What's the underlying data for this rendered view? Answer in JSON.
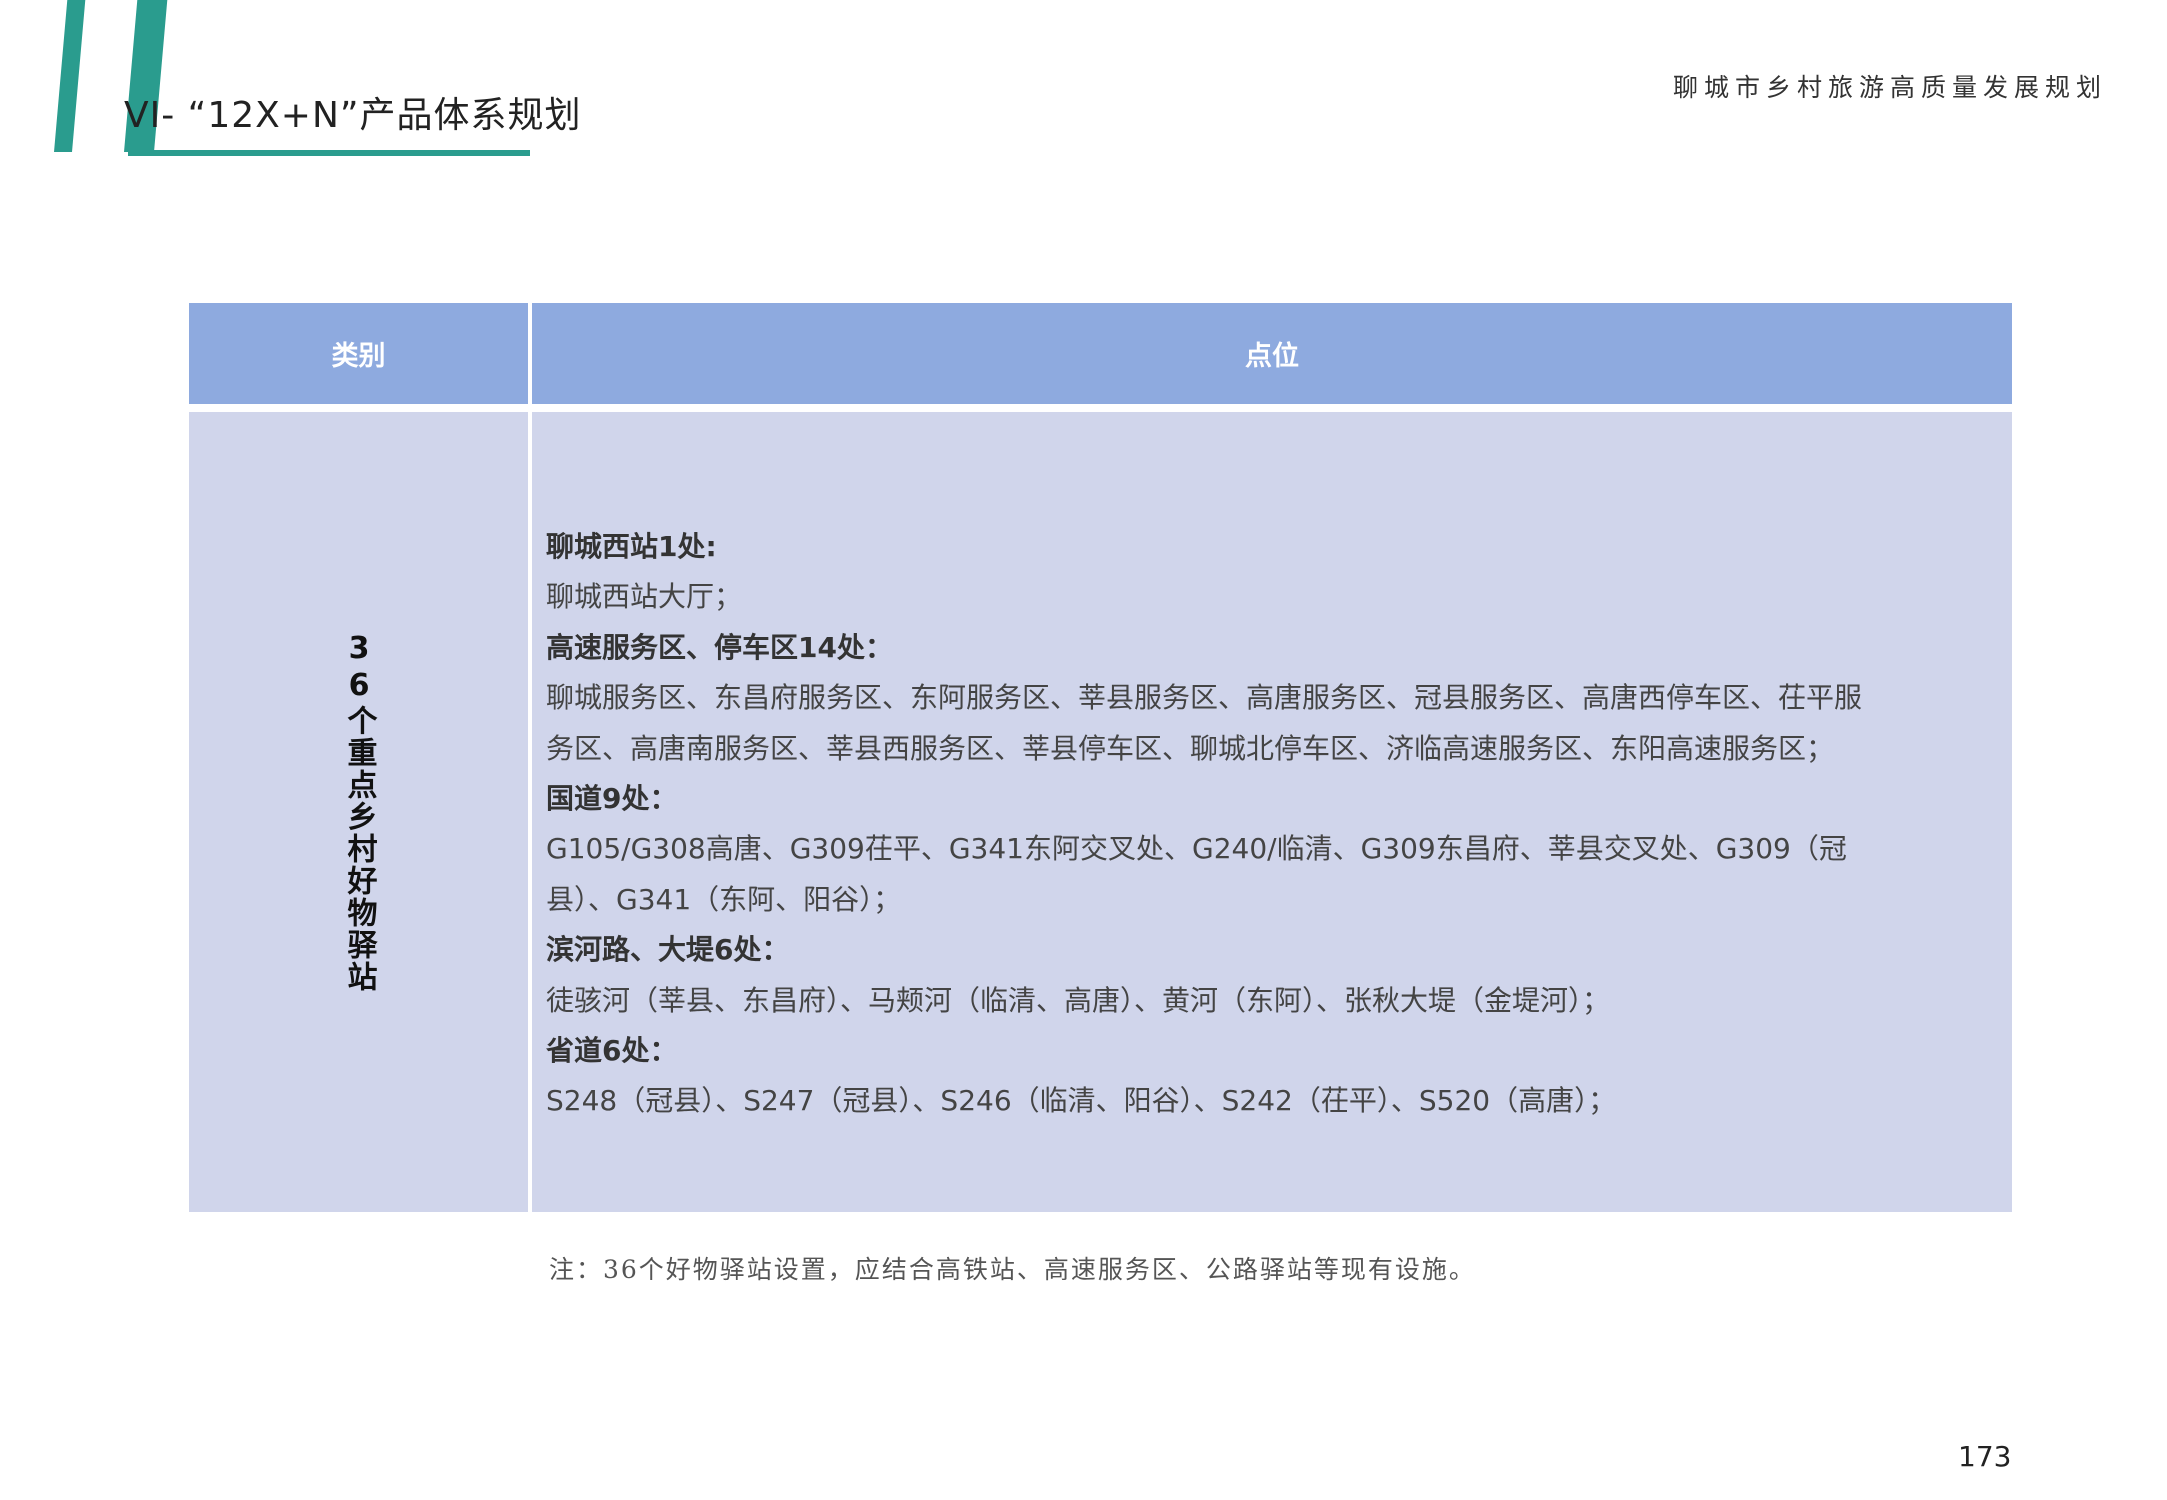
{
  "header": {
    "chapter_title": "VI- “12X+N”产品体系规划",
    "document_title": "聊城市乡村旅游高质量发展规划"
  },
  "table": {
    "headers": {
      "category": "类别",
      "locations": "点位"
    },
    "rows": [
      {
        "category": "36个重点乡村好物驿站",
        "lines": [
          {
            "text": "聊城西站1处:",
            "bold": true
          },
          {
            "text": "聊城西站大厅；",
            "bold": false
          },
          {
            "text": "高速服务区、停车区14处：",
            "bold": true
          },
          {
            "text": "聊城服务区、东昌府服务区、东阿服务区、莘县服务区、高唐服务区、冠县服务区、高唐西停车区、茌平服",
            "bold": false
          },
          {
            "text": "务区、高唐南服务区、莘县西服务区、莘县停车区、聊城北停车区、济临高速服务区、东阳高速服务区；",
            "bold": false
          },
          {
            "text": "国道9处：",
            "bold": true
          },
          {
            "text": "G105/G308高唐、G309茌平、G341东阿交叉处、G240/临清、G309东昌府、莘县交叉处、G309（冠",
            "bold": false
          },
          {
            "text": "县）、G341（东阿、阳谷）；",
            "bold": false
          },
          {
            "text": "滨河路、大堤6处：",
            "bold": true
          },
          {
            "text": "徒骇河（莘县、东昌府）、马颊河（临清、高唐）、黄河（东阿）、张秋大堤（金堤河）；",
            "bold": false
          },
          {
            "text": "省道6处：",
            "bold": true
          },
          {
            "text": "S248（冠县）、S247（冠县）、S246（临清、阳谷）、S242（茌平）、S520（高唐）；",
            "bold": false
          }
        ]
      }
    ]
  },
  "footer": {
    "note": "注：36个好物驿站设置，应结合高铁站、高速服务区、公路驿站等现有设施。",
    "page_number": "173"
  },
  "colors": {
    "accent": "#2a9c8e",
    "header_fill": "#8eaadf",
    "body_fill": "#d0d5eb"
  }
}
